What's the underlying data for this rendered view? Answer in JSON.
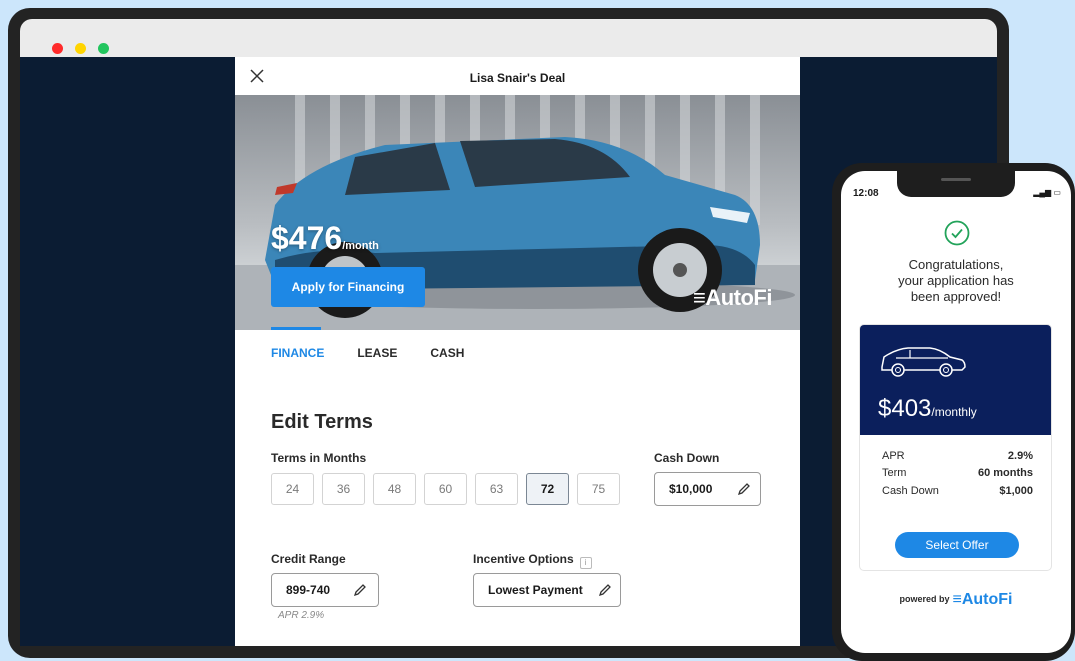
{
  "laptop": {
    "modal": {
      "title": "Lisa Snair's Deal",
      "hero": {
        "price": "$476",
        "price_suffix": "/month",
        "apply_label": "Apply for Financing",
        "brand": "AutoFi"
      },
      "tabs": [
        {
          "label": "FINANCE",
          "active": true
        },
        {
          "label": "LEASE",
          "active": false
        },
        {
          "label": "CASH",
          "active": false
        }
      ],
      "edit_terms": {
        "title": "Edit Terms",
        "terms_label": "Terms in Months",
        "terms": [
          "24",
          "36",
          "48",
          "60",
          "63",
          "72",
          "75"
        ],
        "selected_term": "72",
        "cash_down_label": "Cash Down",
        "cash_down_value": "$10,000",
        "credit_range_label": "Credit Range",
        "credit_range_value": "899-740",
        "apr_note": "APR 2.9%",
        "incentive_label": "Incentive Options",
        "incentive_value": "Lowest Payment"
      }
    }
  },
  "phone": {
    "time": "12:08",
    "message": [
      "Congratulations,",
      "your application has",
      "been approved!"
    ],
    "offer": {
      "price": "$403",
      "price_suffix": "/monthly",
      "rows": [
        {
          "label": "APR",
          "value": "2.9%"
        },
        {
          "label": "Term",
          "value": "60 months"
        },
        {
          "label": "Cash Down",
          "value": "$1,000"
        }
      ],
      "select_label": "Select Offer"
    },
    "powered_by": "powered by",
    "brand": "AutoFi"
  },
  "colors": {
    "accent": "#1e88e5",
    "offer_card_header": "#0b1f5c",
    "success": "#22a35a",
    "background": "#cce6fb"
  }
}
